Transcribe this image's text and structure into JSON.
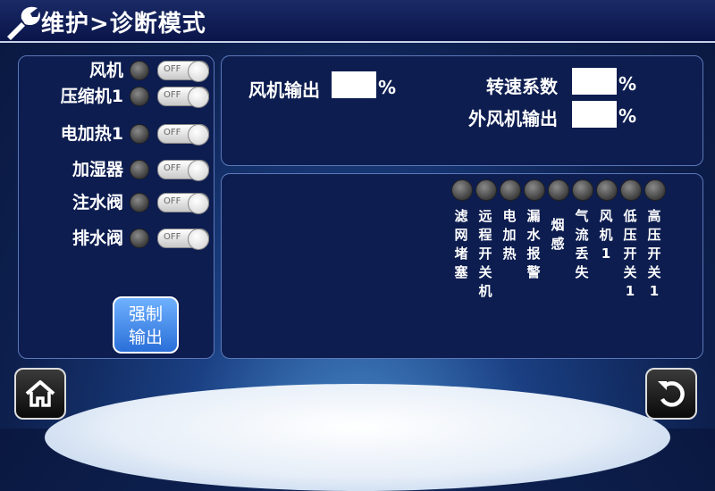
{
  "header": {
    "title": "维护>诊断模式"
  },
  "outputs": [
    {
      "label": "风机",
      "state": "OFF"
    },
    {
      "label": "压缩机1",
      "state": "OFF"
    },
    {
      "label": "电加热1",
      "state": "OFF"
    },
    {
      "label": "加湿器",
      "state": "OFF"
    },
    {
      "label": "注水阀",
      "state": "OFF"
    },
    {
      "label": "排水阀",
      "state": "OFF"
    }
  ],
  "force_output_button": {
    "line1": "强制",
    "line2": "输出"
  },
  "params": {
    "fan_output": {
      "label": "风机输出",
      "value": "",
      "unit": "%"
    },
    "speed_coef": {
      "label": "转速系数",
      "value": "",
      "unit": "%"
    },
    "outdoor_fan_output": {
      "label": "外风机输出",
      "value": "",
      "unit": "%"
    }
  },
  "status_indicators": [
    {
      "label": [
        "滤",
        "网",
        "堵",
        "塞"
      ]
    },
    {
      "label": [
        "远",
        "程",
        "开",
        "关",
        "机"
      ]
    },
    {
      "label": [
        "电",
        "加",
        "热"
      ]
    },
    {
      "label": [
        "漏",
        "水",
        "报",
        "警"
      ]
    },
    {
      "label": [
        "烟",
        "感"
      ]
    },
    {
      "label": [
        "气",
        "流",
        "丢",
        "失"
      ]
    },
    {
      "label": [
        "风",
        "机",
        "1"
      ]
    },
    {
      "label": [
        "低",
        "压",
        "开",
        "关",
        "1"
      ]
    },
    {
      "label": [
        "高",
        "压",
        "开",
        "关",
        "1"
      ]
    }
  ],
  "icons": {
    "header": "wrench-icon",
    "home": "home-icon",
    "back": "back-icon"
  },
  "colors": {
    "panel_border": "#5c78b8",
    "background": "#0d1f4d",
    "button_blue": "#2a6fd8"
  }
}
